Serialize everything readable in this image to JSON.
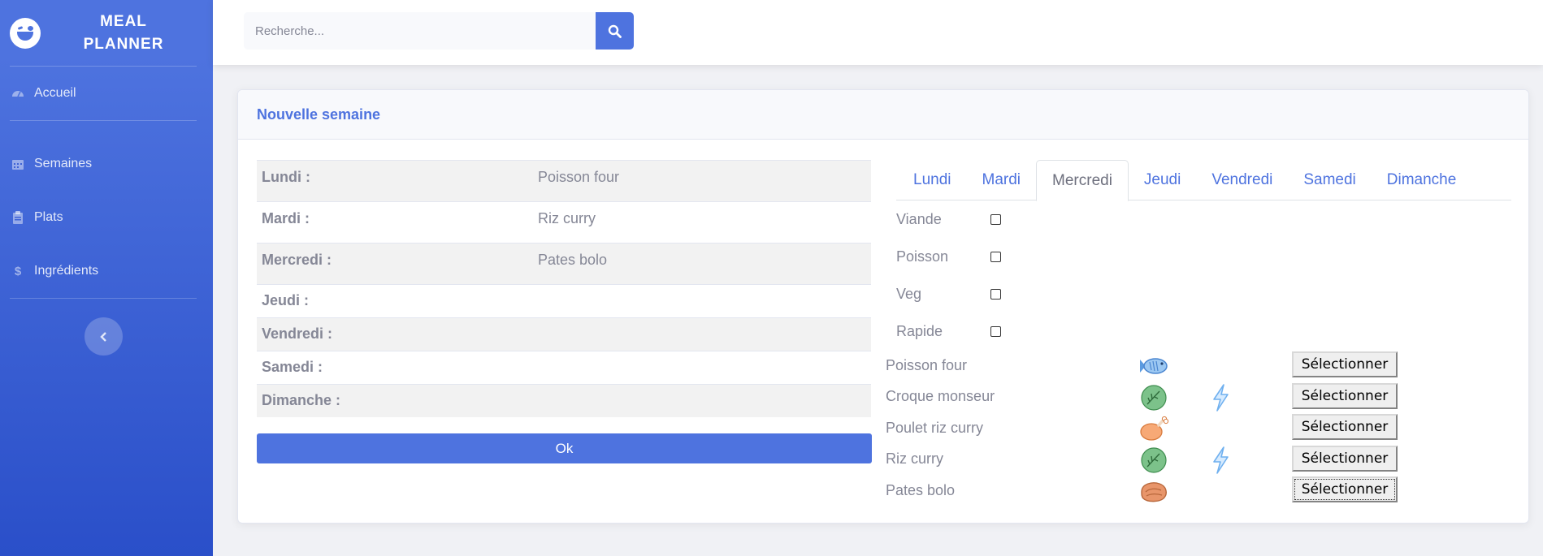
{
  "sidebar": {
    "brand_line1": "MEAL",
    "brand_line2": "PLANNER",
    "items": [
      {
        "label": "Accueil",
        "icon": "tachometer-icon"
      },
      {
        "label": "Semaines",
        "icon": "calendar-icon"
      },
      {
        "label": "Plats",
        "icon": "clipboard-icon"
      },
      {
        "label": "Ingrédients",
        "icon": "dollar-icon"
      }
    ]
  },
  "topbar": {
    "search_placeholder": "Recherche..."
  },
  "card": {
    "title": "Nouvelle semaine"
  },
  "week": [
    {
      "day": "Lundi :",
      "meal": "Poisson four"
    },
    {
      "day": "Mardi :",
      "meal": "Riz curry"
    },
    {
      "day": "Mercredi :",
      "meal": "Pates bolo"
    },
    {
      "day": "Jeudi :",
      "meal": ""
    },
    {
      "day": "Vendredi :",
      "meal": ""
    },
    {
      "day": "Samedi :",
      "meal": ""
    },
    {
      "day": "Dimanche :",
      "meal": ""
    }
  ],
  "ok_label": "Ok",
  "tabs": [
    "Lundi",
    "Mardi",
    "Mercredi",
    "Jeudi",
    "Vendredi",
    "Samedi",
    "Dimanche"
  ],
  "active_tab": "Mercredi",
  "filters": [
    {
      "label": "Viande",
      "checked": false
    },
    {
      "label": "Poisson",
      "checked": false
    },
    {
      "label": "Veg",
      "checked": false
    },
    {
      "label": "Rapide",
      "checked": false
    }
  ],
  "dishes": [
    {
      "name": "Poisson four",
      "type_icon": "fish-icon",
      "quick": false,
      "button": "Sélectionner"
    },
    {
      "name": "Croque monseur",
      "type_icon": "leaf-icon",
      "quick": true,
      "button": "Sélectionner"
    },
    {
      "name": "Poulet riz curry",
      "type_icon": "chicken-icon",
      "quick": false,
      "button": "Sélectionner"
    },
    {
      "name": "Riz curry",
      "type_icon": "leaf-icon",
      "quick": true,
      "button": "Sélectionner"
    },
    {
      "name": "Pates bolo",
      "type_icon": "steak-icon",
      "quick": false,
      "button": "Sélectionner"
    }
  ],
  "colors": {
    "primary": "#4e73df",
    "text_muted": "#858796",
    "sidebar_bottom": "#2a4fc9"
  }
}
